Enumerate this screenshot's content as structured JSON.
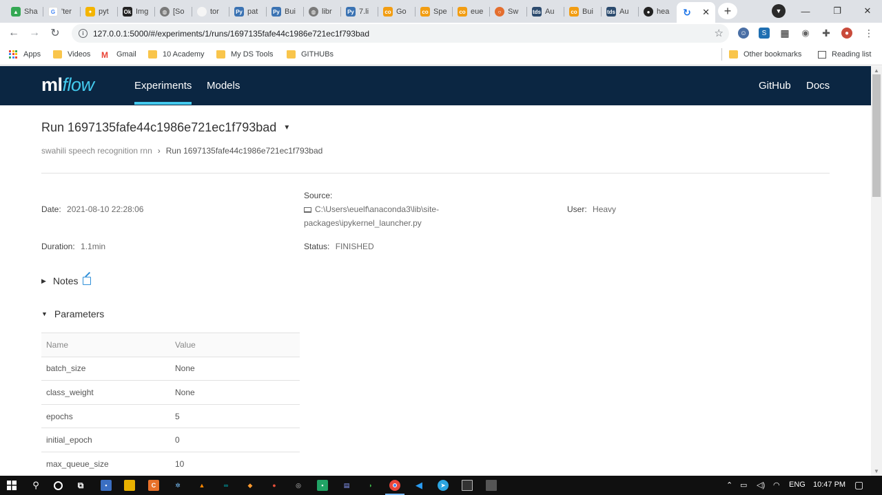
{
  "browser": {
    "tabs": [
      {
        "label": "Sha",
        "icon": "google-drive-icon",
        "color": "#34a853"
      },
      {
        "label": "'ter",
        "icon": "google-icon",
        "color": "#4285f4"
      },
      {
        "label": "pyt",
        "icon": "fire-icon",
        "color": "#f4b400"
      },
      {
        "label": "Img",
        "icon": "dark-app-icon",
        "color": "#222222"
      },
      {
        "label": "[So",
        "icon": "globe-icon",
        "color": "#7a7a7a"
      },
      {
        "label": "tor",
        "icon": "blank-page-icon",
        "color": "#f5f5f5"
      },
      {
        "label": "pat",
        "icon": "python-icon",
        "color": "#3b73b3"
      },
      {
        "label": "Bui",
        "icon": "python-icon",
        "color": "#3b73b3"
      },
      {
        "label": "libr",
        "icon": "globe-icon",
        "color": "#7a7a7a"
      },
      {
        "label": "7.li",
        "icon": "python-icon",
        "color": "#3b73b3"
      },
      {
        "label": "Go",
        "icon": "colab-icon",
        "color": "#f29d12"
      },
      {
        "label": "Spe",
        "icon": "colab-icon",
        "color": "#f29d12"
      },
      {
        "label": "eue",
        "icon": "colab-icon",
        "color": "#f29d12"
      },
      {
        "label": "Sw",
        "icon": "jupyter-icon",
        "color": "#e46e2e"
      },
      {
        "label": "Au",
        "icon": "tds-icon",
        "color": "#2c4b6e"
      },
      {
        "label": "Bui",
        "icon": "colab-icon",
        "color": "#f29d12"
      },
      {
        "label": "Au",
        "icon": "tds-icon",
        "color": "#2c4b6e"
      },
      {
        "label": "hea",
        "icon": "github-icon",
        "color": "#222222"
      },
      {
        "label": "",
        "icon": "loading-icon",
        "color": "#1a73e8"
      }
    ],
    "url": "127.0.0.1:5000/#/experiments/1/runs/1697135fafe44c1986e721ec1f793bad",
    "bookmarks": [
      "Apps",
      "Videos",
      "Gmail",
      "10 Academy",
      "My DS Tools",
      "GITHUBs"
    ],
    "other_bookmarks": "Other bookmarks",
    "reading_list": "Reading list"
  },
  "header": {
    "logo_ml": "ml",
    "logo_flow": "flow",
    "nav": [
      "Experiments",
      "Models"
    ],
    "right_links": [
      "GitHub",
      "Docs"
    ]
  },
  "run": {
    "title": "Run 1697135fafe44c1986e721ec1f793bad",
    "breadcrumb": {
      "experiment": "swahili speech recognition rnn",
      "current": "Run 1697135fafe44c1986e721ec1f793bad"
    },
    "date_label": "Date",
    "date": "2021-08-10 22:28:06",
    "duration_label": "Duration",
    "duration": "1.1min",
    "source_label": "Source",
    "source_line1": "C:\\Users\\euelf\\anaconda3\\lib\\site-",
    "source_line2": "packages\\ipykernel_launcher.py",
    "status_label": "Status",
    "status": "FINISHED",
    "user_label": "User",
    "user": "Heavy"
  },
  "notes": {
    "label": "Notes"
  },
  "parameters": {
    "label": "Parameters",
    "columns": [
      "Name",
      "Value"
    ],
    "rows": [
      {
        "name": "batch_size",
        "value": "None"
      },
      {
        "name": "class_weight",
        "value": "None"
      },
      {
        "name": "epochs",
        "value": "5"
      },
      {
        "name": "initial_epoch",
        "value": "0"
      },
      {
        "name": "max_queue_size",
        "value": "10"
      }
    ]
  },
  "taskbar": {
    "lang": "ENG",
    "time": "10:47 PM"
  },
  "colors": {
    "header_bg": "#0b2642",
    "accent": "#43c9ed"
  }
}
